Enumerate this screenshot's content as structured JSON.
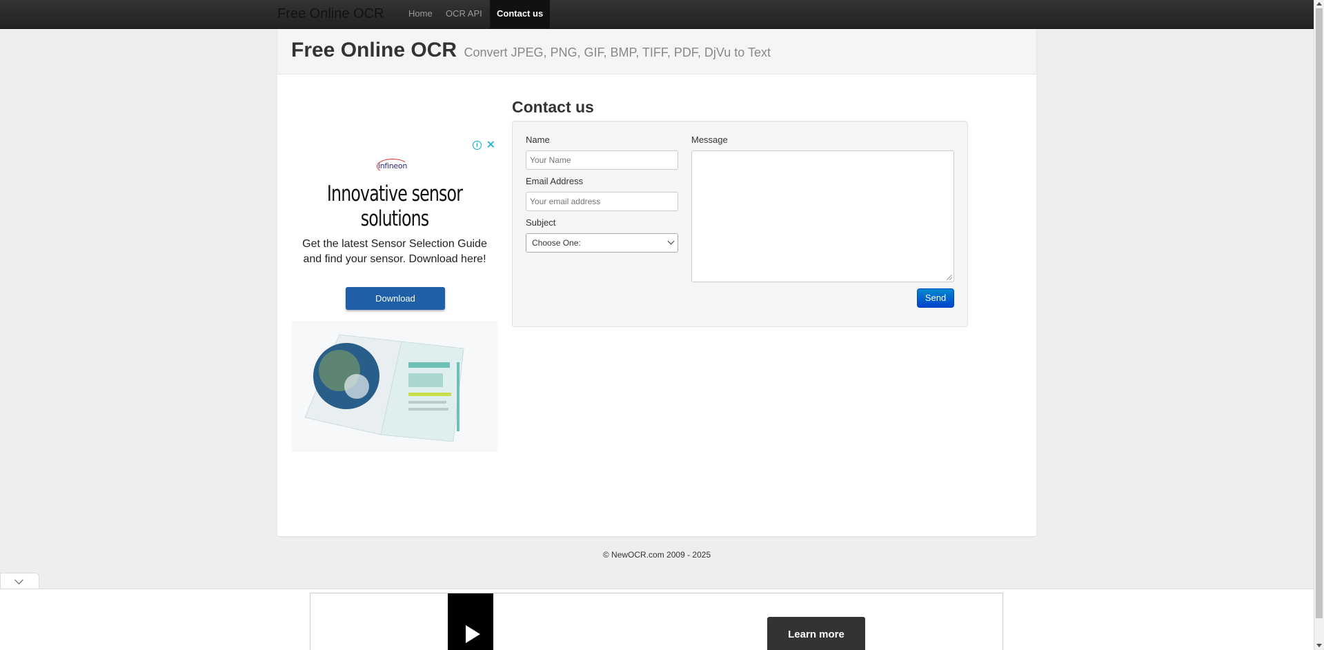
{
  "navbar": {
    "brand": "Free Online OCR",
    "items": [
      {
        "label": "Home"
      },
      {
        "label": "OCR API"
      },
      {
        "label": "Contact us",
        "active": true
      }
    ]
  },
  "hero": {
    "title": "Free Online OCR",
    "subtitle": "Convert JPEG, PNG, GIF, BMP, TIFF, PDF, DjVu to Text"
  },
  "ad": {
    "logo": "infineon",
    "headline": "Innovative sensor solutions",
    "body": "Get the latest Sensor Selection Guide and find your sensor. Download here!",
    "cta": "Download",
    "info_icon": "info-icon",
    "close_icon": "close-icon"
  },
  "contact": {
    "title": "Contact us",
    "name_label": "Name",
    "name_placeholder": "Your Name",
    "email_label": "Email Address",
    "email_placeholder": "Your email address",
    "subject_label": "Subject",
    "subject_selected": "Choose One:",
    "message_label": "Message",
    "send_label": "Send"
  },
  "footer": {
    "copyright": "© NewOCR.com 2009 - 2025"
  },
  "bottom_ad": {
    "cta": "Learn more"
  },
  "colors": {
    "navbar": "#222222",
    "send_button": "#0055cc",
    "ad_cta": "#1e5fa8",
    "ad_accent": "#00aecd"
  }
}
